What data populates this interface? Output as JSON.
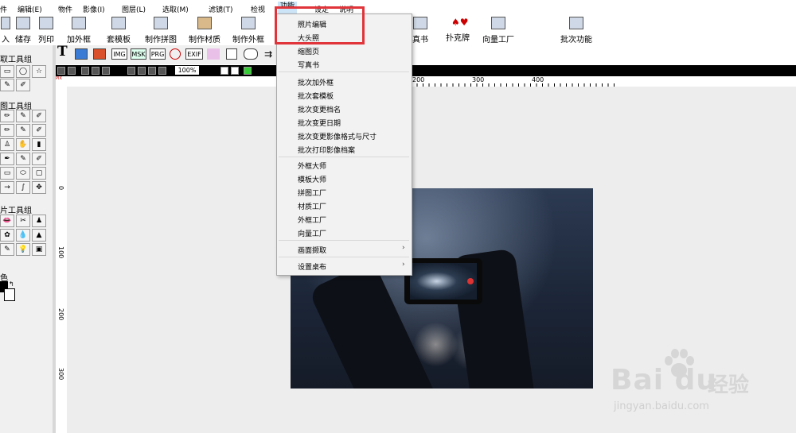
{
  "menubar": {
    "items": [
      "件",
      "编辑(E)",
      "物件",
      "影像(I)",
      "图层(L)",
      "选取(M)",
      "滤镜(T)",
      "检视",
      "功能",
      "设定",
      "说明"
    ],
    "active": "功能"
  },
  "toolbar": {
    "buttons": [
      "入",
      "储存",
      "列印",
      "加外框",
      "套模板",
      "制作拼图",
      "制作材质",
      "制作外框",
      "真书",
      "扑克牌",
      "向量工厂",
      "批次功能"
    ]
  },
  "left_panel": {
    "groups": [
      "取工具组",
      "图工具组",
      "片工具组"
    ],
    "color_label": "色"
  },
  "object_bar": {
    "text_tool": "T",
    "icons": [
      "IMG",
      "MSK",
      "PRG",
      "EXIF"
    ]
  },
  "navbar": {
    "zoom": "100%"
  },
  "ruler": {
    "h_labels": [
      "200",
      "300",
      "400"
    ],
    "v_labels": [
      "0",
      "100",
      "200",
      "300"
    ]
  },
  "dropdown": {
    "items": [
      "照片编辑",
      "大头照",
      "缩图页",
      "写真书",
      "批次加外框",
      "批次套模板",
      "批次变更档名",
      "批次变更日期",
      "批次变更影像格式与尺寸",
      "批次打印影像档案",
      "外框大师",
      "模板大师",
      "拼图工厂",
      "材质工厂",
      "外框工厂",
      "向量工厂",
      "画面撷取",
      "设置桌布"
    ],
    "submenu_arrow": "›"
  },
  "watermark": {
    "logo": "Bai du",
    "cn": "经验",
    "url": "jingyan.baidu.com"
  },
  "colors": {
    "highlight": "#e0343a",
    "menu_active": "#cce4f7"
  }
}
